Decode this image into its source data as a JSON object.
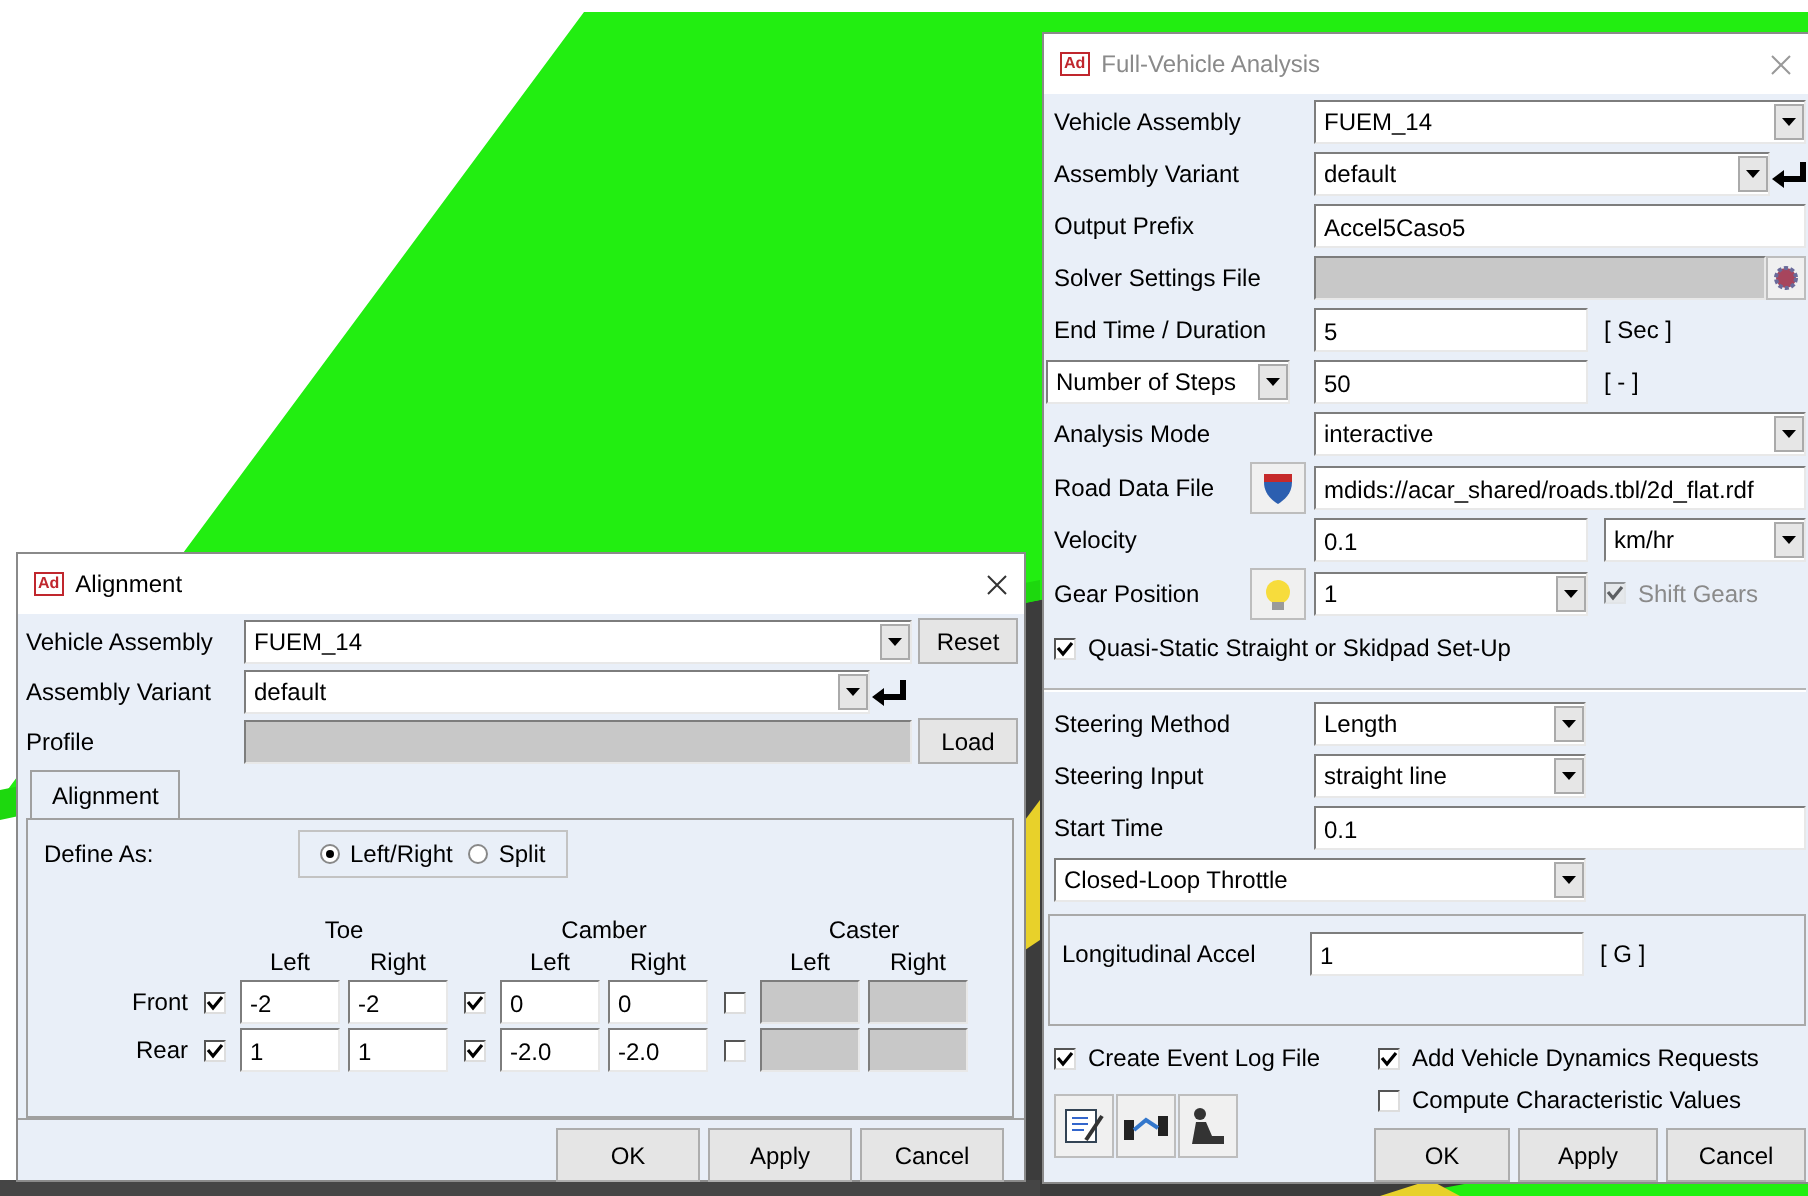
{
  "analysis": {
    "badge": "Ad",
    "title": "Full-Vehicle Analysis",
    "rows": [
      {
        "kind": "combo",
        "label": "Vehicle Assembly",
        "value": "FUEM_14"
      },
      {
        "kind": "combo_enter",
        "label": "Assembly Variant",
        "value": "default"
      },
      {
        "kind": "text",
        "label": "Output Prefix",
        "value": "Accel5Caso5"
      },
      {
        "kind": "file",
        "label": "Solver Settings File"
      },
      {
        "kind": "unit",
        "label": "End Time / Duration",
        "value": "5",
        "unit": "[ Sec ]"
      },
      {
        "kind": "select_unit",
        "label": "Number of Steps",
        "value": "50",
        "unit": "[ - ]"
      },
      {
        "kind": "combo",
        "label": "Analysis Mode",
        "value": "interactive"
      },
      {
        "kind": "road",
        "label": "Road Data File",
        "value": "mdids://acar_shared/roads.tbl/2d_flat.rdf"
      },
      {
        "kind": "unit_combo",
        "label": "Velocity",
        "value": "0.1",
        "unit": "km/hr"
      },
      {
        "kind": "gear",
        "label": "Gear Position",
        "value": "1",
        "check": {
          "label": "Shift Gears",
          "checked": true,
          "disabled": true
        }
      }
    ],
    "quasi": {
      "label": "Quasi-Static Straight or Skidpad Set-Up",
      "checked": true
    },
    "steering": [
      {
        "kind": "short_combo",
        "label": "Steering Method",
        "value": "Length"
      },
      {
        "kind": "short_combo",
        "label": "Steering Input",
        "value": "straight line"
      },
      {
        "kind": "text",
        "label": "Start Time",
        "value": "0.1"
      }
    ],
    "throttle": "Closed-Loop Throttle",
    "accel": {
      "label": "Longitudinal Accel",
      "value": "1",
      "unit": "[ G ]"
    },
    "log": {
      "label": "Create Event Log File",
      "checked": true
    },
    "options": [
      {
        "label": "Add Vehicle Dynamics Requests",
        "checked": true
      },
      {
        "label": "Compute Characteristic Values",
        "checked": false
      }
    ],
    "buttons": [
      "OK",
      "Apply",
      "Cancel"
    ]
  },
  "alignment": {
    "badge": "Ad",
    "title": "Alignment",
    "assembly": {
      "label": "Vehicle Assembly",
      "value": "FUEM_14",
      "button": "Reset"
    },
    "variant": {
      "label": "Assembly Variant",
      "value": "default"
    },
    "profile": {
      "label": "Profile",
      "button": "Load"
    },
    "tabs": [
      {
        "label": "Alignment",
        "selected": true
      }
    ],
    "define_as": {
      "label": "Define As:",
      "options": [
        {
          "label": "Left/Right",
          "selected": true
        },
        {
          "label": "Split",
          "selected": false
        }
      ]
    },
    "groups": [
      {
        "title": "Toe",
        "columns": [
          "Left",
          "Right"
        ]
      },
      {
        "title": "Camber",
        "columns": [
          "Left",
          "Right"
        ]
      },
      {
        "title": "Caster",
        "columns": [
          "Left",
          "Right"
        ]
      }
    ],
    "rows": [
      {
        "label": "Front",
        "cells": [
          {
            "checked": true,
            "values": [
              "-2",
              "-2"
            ]
          },
          {
            "checked": true,
            "values": [
              "0",
              "0"
            ]
          },
          {
            "checked": false
          }
        ]
      },
      {
        "label": "Rear",
        "cells": [
          {
            "checked": true,
            "values": [
              "1",
              "1"
            ]
          },
          {
            "checked": true,
            "values": [
              "-2.0",
              "-2.0"
            ]
          },
          {
            "checked": false
          }
        ]
      }
    ],
    "buttons": [
      "OK",
      "Apply",
      "Cancel"
    ]
  }
}
